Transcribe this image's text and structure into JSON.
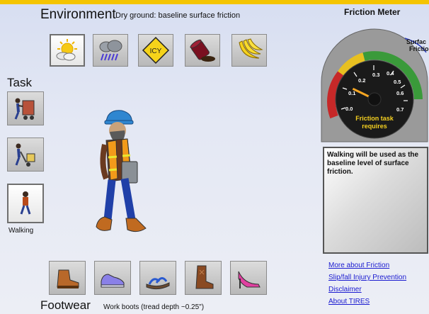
{
  "environment": {
    "title": "Environment",
    "description": "Dry ground: baseline surface friction",
    "options": [
      {
        "icon": "sun-cloud-icon",
        "selected": true
      },
      {
        "icon": "rain-cloud-icon",
        "selected": false
      },
      {
        "icon": "icy-sign-icon",
        "sign_text": "ICY",
        "selected": false
      },
      {
        "icon": "oil-spill-icon",
        "selected": false
      },
      {
        "icon": "bananas-icon",
        "selected": false
      }
    ]
  },
  "task": {
    "title": "Task",
    "options": [
      {
        "icon": "pushing-cart-icon"
      },
      {
        "icon": "pulling-dolly-icon"
      },
      {
        "icon": "walking-icon"
      }
    ],
    "selected_label": "Walking"
  },
  "footwear": {
    "title": "Footwear",
    "description": "Work boots (tread depth ~0.25\")",
    "options": [
      {
        "icon": "work-boot-icon"
      },
      {
        "icon": "sneaker-icon"
      },
      {
        "icon": "sandal-icon"
      },
      {
        "icon": "cowboy-boot-icon"
      },
      {
        "icon": "high-heel-icon"
      }
    ]
  },
  "meter": {
    "title": "Friction Meter",
    "surface_label": "Surface Friction",
    "surface_label_l1": "Surfac",
    "surface_label_l2": "Frictio",
    "ticks": [
      "0.0",
      "0.1",
      "0.2",
      "0.3",
      "0.4",
      "0.5",
      "0.6",
      "0.7"
    ],
    "required_label_l1": "Friction task",
    "required_label_l2": "requires",
    "needle_value": 0.2,
    "colors": {
      "red": "#c62828",
      "yellow": "#e8c020",
      "green": "#3a9a3a",
      "face": "#1a1a1a",
      "needle": "#f5a623"
    }
  },
  "info": {
    "text": "Walking will be used as the baseline level of surface friction."
  },
  "links": {
    "more_friction": "More about Friction",
    "slip_fall": "Slip/fall Injury Prevention",
    "disclaimer": "Disclaimer",
    "about": "About TIRES"
  }
}
